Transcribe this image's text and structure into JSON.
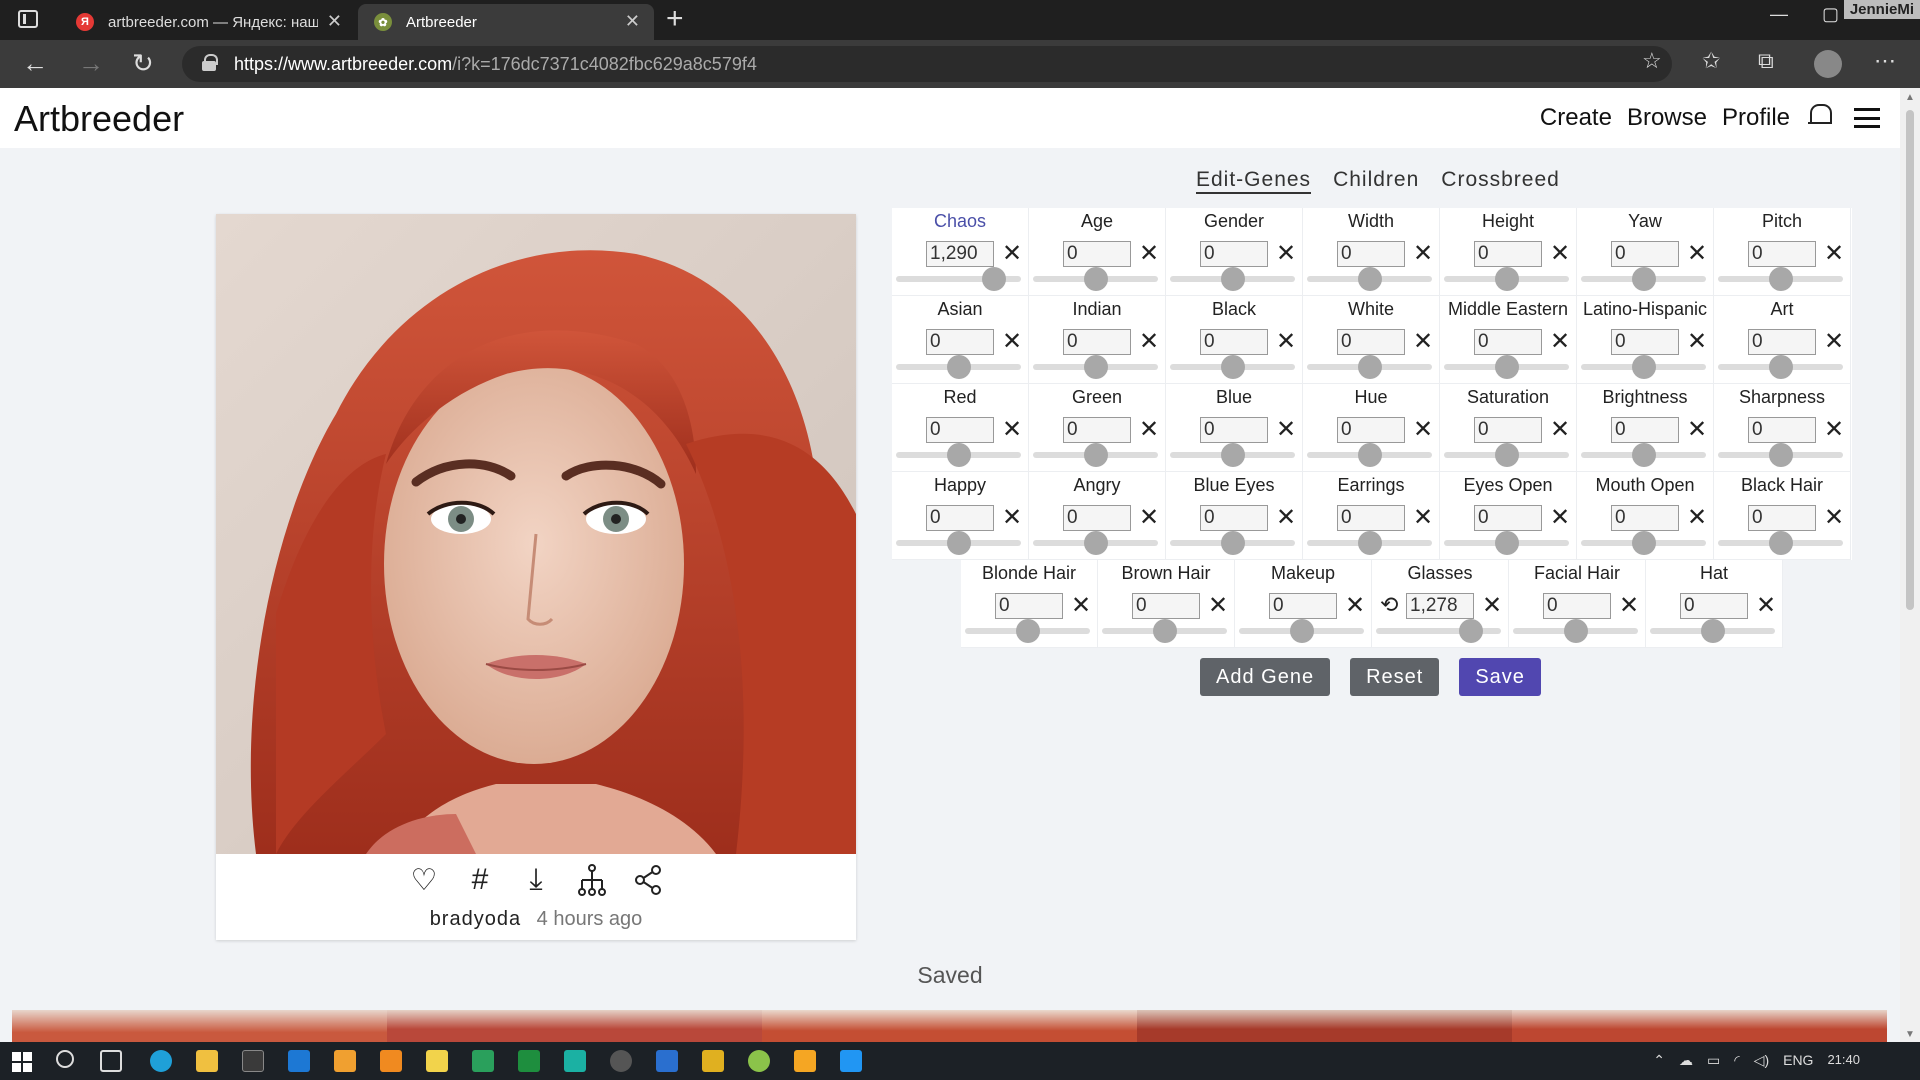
{
  "browser": {
    "tabs": [
      {
        "title": "artbreeder.com — Яндекс: нашл",
        "favicon": "Я"
      },
      {
        "title": "Artbreeder",
        "favicon": ""
      }
    ],
    "url_host": "https://www.artbreeder.com",
    "url_rest": "/i?k=176dc7371c4082fbc629a8c579f4",
    "watermark": "JennieMi"
  },
  "site": {
    "logo": "Artbreeder",
    "nav": [
      "Create",
      "Browse",
      "Profile"
    ]
  },
  "card": {
    "user": "bradyoda",
    "time": "4 hours ago"
  },
  "edit_tabs": [
    "Edit-Genes",
    "Children",
    "Crossbreed"
  ],
  "gene_rows": [
    [
      {
        "label": "Chaos",
        "value": "1,290",
        "level": 0.78,
        "link": true
      },
      {
        "label": "Age",
        "value": "0",
        "level": 0.5
      },
      {
        "label": "Gender",
        "value": "0",
        "level": 0.5
      },
      {
        "label": "Width",
        "value": "0",
        "level": 0.5
      },
      {
        "label": "Height",
        "value": "0",
        "level": 0.5
      },
      {
        "label": "Yaw",
        "value": "0",
        "level": 0.5
      },
      {
        "label": "Pitch",
        "value": "0",
        "level": 0.5
      }
    ],
    [
      {
        "label": "Asian",
        "value": "0",
        "level": 0.5
      },
      {
        "label": "Indian",
        "value": "0",
        "level": 0.5
      },
      {
        "label": "Black",
        "value": "0",
        "level": 0.5
      },
      {
        "label": "White",
        "value": "0",
        "level": 0.5
      },
      {
        "label": "Middle Eastern",
        "value": "0",
        "level": 0.5
      },
      {
        "label": "Latino-Hispanic",
        "value": "0",
        "level": 0.5
      },
      {
        "label": "Art",
        "value": "0",
        "level": 0.5
      }
    ],
    [
      {
        "label": "Red",
        "value": "0",
        "level": 0.5
      },
      {
        "label": "Green",
        "value": "0",
        "level": 0.5
      },
      {
        "label": "Blue",
        "value": "0",
        "level": 0.5
      },
      {
        "label": "Hue",
        "value": "0",
        "level": 0.5
      },
      {
        "label": "Saturation",
        "value": "0",
        "level": 0.5
      },
      {
        "label": "Brightness",
        "value": "0",
        "level": 0.5
      },
      {
        "label": "Sharpness",
        "value": "0",
        "level": 0.5
      }
    ],
    [
      {
        "label": "Happy",
        "value": "0",
        "level": 0.5
      },
      {
        "label": "Angry",
        "value": "0",
        "level": 0.5
      },
      {
        "label": "Blue Eyes",
        "value": "0",
        "level": 0.5
      },
      {
        "label": "Earrings",
        "value": "0",
        "level": 0.5
      },
      {
        "label": "Eyes Open",
        "value": "0",
        "level": 0.5
      },
      {
        "label": "Mouth Open",
        "value": "0",
        "level": 0.5
      },
      {
        "label": "Black Hair",
        "value": "0",
        "level": 0.5
      }
    ],
    [
      {
        "label": "Blonde Hair",
        "value": "0",
        "level": 0.5
      },
      {
        "label": "Brown Hair",
        "value": "0",
        "level": 0.5
      },
      {
        "label": "Makeup",
        "value": "0",
        "level": 0.5
      },
      {
        "label": "Glasses",
        "value": "1,278",
        "level": 0.76,
        "undo": true
      },
      {
        "label": "Facial Hair",
        "value": "0",
        "level": 0.5
      },
      {
        "label": "Hat",
        "value": "0",
        "level": 0.5
      }
    ]
  ],
  "buttons": {
    "add_gene": "Add Gene",
    "reset": "Reset",
    "save": "Save"
  },
  "saved_label": "Saved",
  "tray": {
    "lang": "ENG",
    "time": "21:40"
  },
  "colors": {
    "accent": "#5147b0",
    "link": "#4a4fa8",
    "hair": "#c8442a"
  }
}
